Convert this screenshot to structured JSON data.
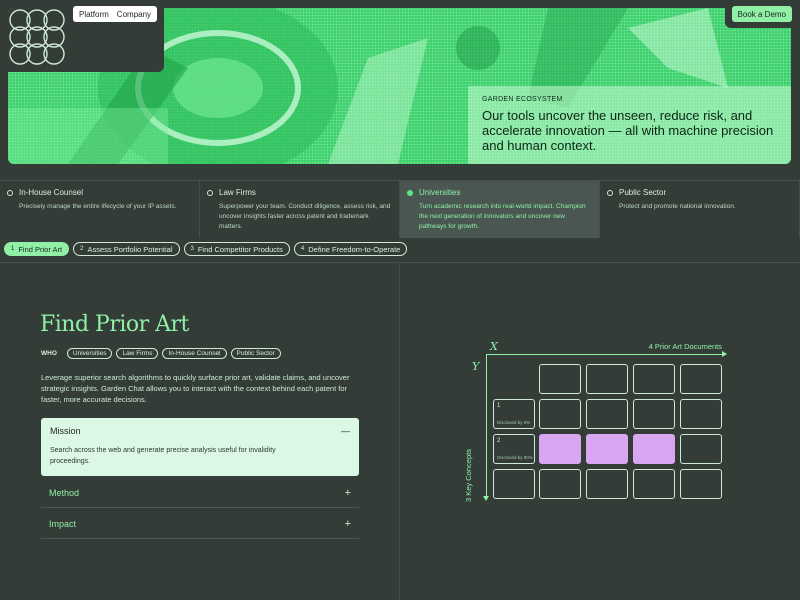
{
  "nav": {
    "items": [
      "Platform",
      "Company"
    ],
    "cta": "Book a Demo"
  },
  "hero": {
    "eyebrow": "GARDEN ECOSYSTEM",
    "headline": "Our tools uncover the unseen, reduce risk, and accelerate innovation — all with machine precision and human context."
  },
  "audiences": [
    {
      "label": "In-House Counsel",
      "desc": "Precisely manage the entire lifecycle of your IP assets.",
      "active": false
    },
    {
      "label": "Law Firms",
      "desc": "Superpower your team. Conduct diligence, assess risk, and uncover insights faster across patent and trademark matters.",
      "active": false
    },
    {
      "label": "Universities",
      "desc": "Turn academic research into real-world impact. Champion the next generation of innovators and uncover new pathways for growth.",
      "active": true
    },
    {
      "label": "Public Sector",
      "desc": "Protect and promote national innovation.",
      "active": false
    }
  ],
  "steps": [
    {
      "num": "1",
      "label": "Find Prior Art",
      "active": true
    },
    {
      "num": "2",
      "label": "Assess Portfolio Potential",
      "active": false
    },
    {
      "num": "3",
      "label": "Find Competitor Products",
      "active": false
    },
    {
      "num": "4",
      "label": "Define Freedom-to-Operate",
      "active": false
    }
  ],
  "main": {
    "title": "Find Prior Art",
    "who_label": "WHO",
    "who_chips": [
      "Universities",
      "Law Firms",
      "In-House Counsel",
      "Public Sector"
    ],
    "intro": "Leverage superior search algorithms to quickly surface prior art, validate claims, and uncover strategic insights. Garden Chat allows you to interact with the context behind each patent for faster, more accurate decisions.",
    "accordion": {
      "open_title": "Mission",
      "open_sign": "—",
      "open_body": "Search across the web and generate precise analysis useful for invalidity proceedings.",
      "closed": [
        {
          "label": "Method",
          "sign": "+"
        },
        {
          "label": "Impact",
          "sign": "+"
        }
      ]
    }
  },
  "diagram": {
    "x_axis": "X",
    "y_axis": "Y",
    "x_count_label": "4 Prior Art Documents",
    "y_count_label": "3 Key Concepts",
    "rows": [
      {
        "num": "1",
        "disclosed": "Disclosed by 0%"
      },
      {
        "num": "2",
        "disclosed": "Disclosed by 80%"
      }
    ]
  }
}
